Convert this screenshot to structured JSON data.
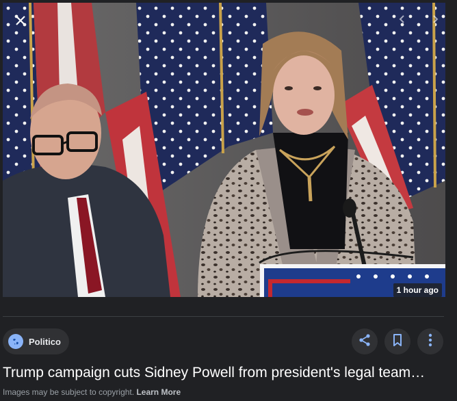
{
  "viewer": {
    "close_icon": "close-icon",
    "prev_icon": "chevron-left-icon",
    "next_icon": "chevron-right-icon",
    "timestamp": "1 hour ago"
  },
  "source": {
    "name": "Politico",
    "icon": "globe-icon"
  },
  "actions": {
    "share_icon": "share-icon",
    "save_icon": "bookmark-icon",
    "more_icon": "more-vert-icon"
  },
  "article": {
    "title": "Trump campaign cuts Sidney Powell from president's legal team…"
  },
  "footer": {
    "copyright_text": "Images may be subject to copyright.",
    "learn_more": "Learn More"
  },
  "colors": {
    "background": "#202124",
    "chip": "#303134",
    "accent_blue": "#8ab4f8",
    "text_primary": "#e8eaed",
    "text_muted": "#9aa0a6"
  }
}
